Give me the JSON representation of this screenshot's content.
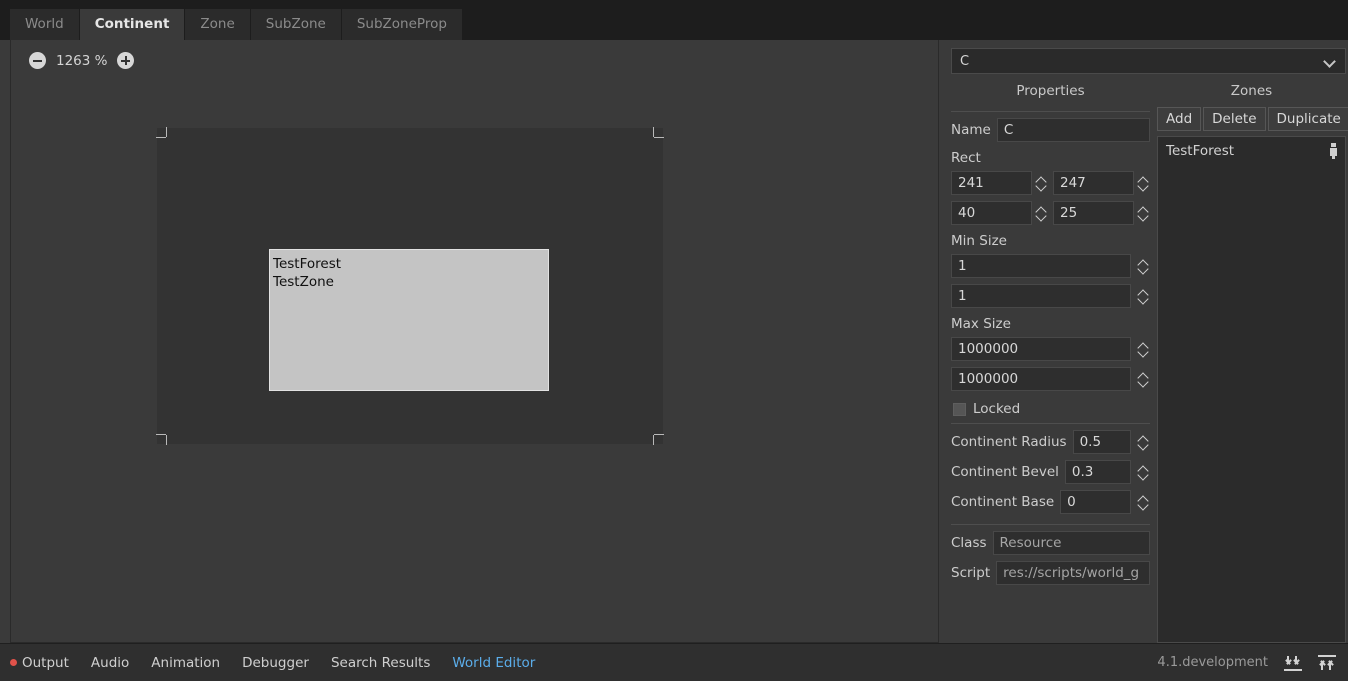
{
  "tabs": [
    {
      "label": "World",
      "active": false
    },
    {
      "label": "Continent",
      "active": true
    },
    {
      "label": "Zone",
      "active": false
    },
    {
      "label": "SubZone",
      "active": false
    },
    {
      "label": "SubZoneProp",
      "active": false
    }
  ],
  "canvas": {
    "zoom_level": "1263 %",
    "zoom_out_icon": "circle-minus-icon",
    "zoom_in_icon": "circle-plus-icon",
    "zone_box": {
      "line1": "TestForest",
      "line2": "TestZone"
    }
  },
  "inspector": {
    "object_selector": {
      "value": "C",
      "chevron_icon": "chevron-down-icon"
    },
    "properties": {
      "title": "Properties",
      "name_label": "Name",
      "name_value": "C",
      "rect_label": "Rect",
      "rect_x": "241",
      "rect_y": "247",
      "rect_w": "40",
      "rect_h": "25",
      "min_size_label": "Min Size",
      "min_w": "1",
      "min_h": "1",
      "max_size_label": "Max Size",
      "max_w": "1000000",
      "max_h": "1000000",
      "locked_label": "Locked",
      "locked_checked": false,
      "continent_radius_label": "Continent Radius",
      "continent_radius_value": "0.5",
      "continent_bevel_label": "Continent Bevel",
      "continent_bevel_value": "0.3",
      "continent_base_label": "Continent Base",
      "continent_base_value": "0",
      "class_label": "Class",
      "class_value": "Resource",
      "script_label": "Script",
      "script_value": "res://scripts/world_g"
    },
    "zones": {
      "title": "Zones",
      "add_label": "Add",
      "delete_label": "Delete",
      "duplicate_label": "Duplicate",
      "items": [
        {
          "label": "TestForest",
          "edit_icon": "pencil-icon"
        }
      ]
    }
  },
  "statusbar": {
    "items": [
      {
        "label": "Output",
        "accent": false,
        "has_error_dot": true
      },
      {
        "label": "Audio",
        "accent": false,
        "has_error_dot": false
      },
      {
        "label": "Animation",
        "accent": false,
        "has_error_dot": false
      },
      {
        "label": "Debugger",
        "accent": false,
        "has_error_dot": false
      },
      {
        "label": "Search Results",
        "accent": false,
        "has_error_dot": false
      },
      {
        "label": "World Editor",
        "accent": true,
        "has_error_dot": false
      }
    ],
    "version": "4.1.development",
    "expand_down_icon": "expand-bottom-icon",
    "expand_up_icon": "expand-top-icon"
  },
  "colors": {
    "accent": "#5badea",
    "error_dot": "#e0524a",
    "panel_bg": "#3a3a3a",
    "field_bg": "#2e2e2e",
    "zone_fill": "#c4c4c4"
  }
}
